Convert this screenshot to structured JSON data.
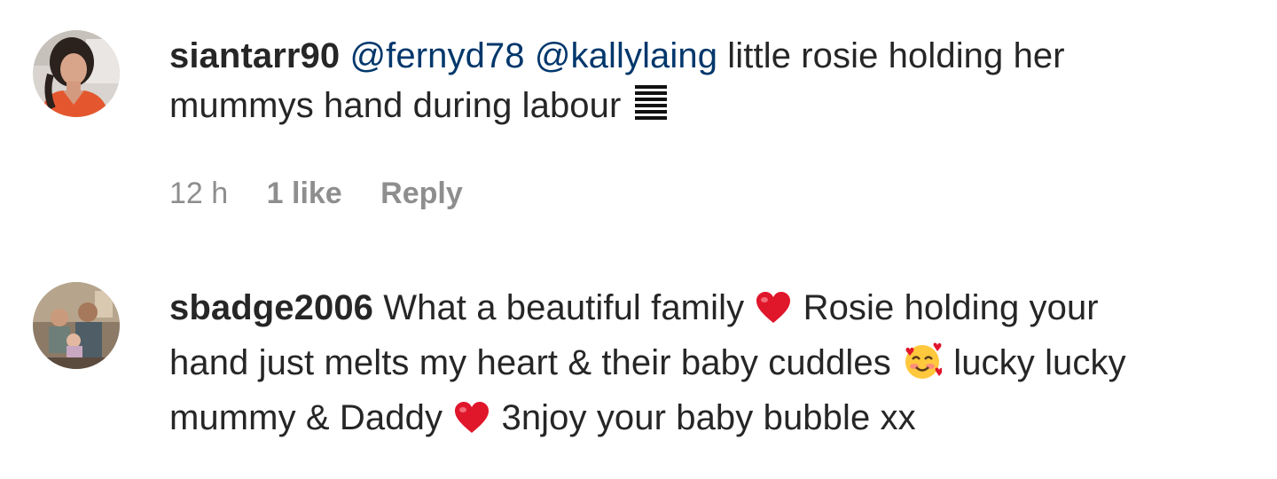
{
  "comments": [
    {
      "username": "siantarr90",
      "mentions": [
        "@fernyd78",
        "@kallylaing"
      ],
      "text_line1": " little rosie holding her",
      "text_line2": "mummys hand during labour",
      "trailing_icon": "building-emoji-icon",
      "time": "12 h",
      "likes": "1 like",
      "reply_label": "Reply"
    },
    {
      "username": "sbadge2006",
      "text_part1": " What a beautiful family ",
      "text_part2": " Rosie holding your",
      "text_part3": "hand just melts my heart & their baby cuddles ",
      "text_part4": " lucky lucky",
      "text_part5": "mummy & Daddy ",
      "text_part6": " 3njoy your baby bubble xx",
      "icons": [
        "red-heart-emoji-icon",
        "smiling-face-with-hearts-emoji-icon",
        "red-heart-emoji-icon"
      ]
    }
  ],
  "colors": {
    "text": "#262626",
    "mention": "#00376b",
    "meta": "#8e8e8e",
    "heart": "#e0162b"
  }
}
